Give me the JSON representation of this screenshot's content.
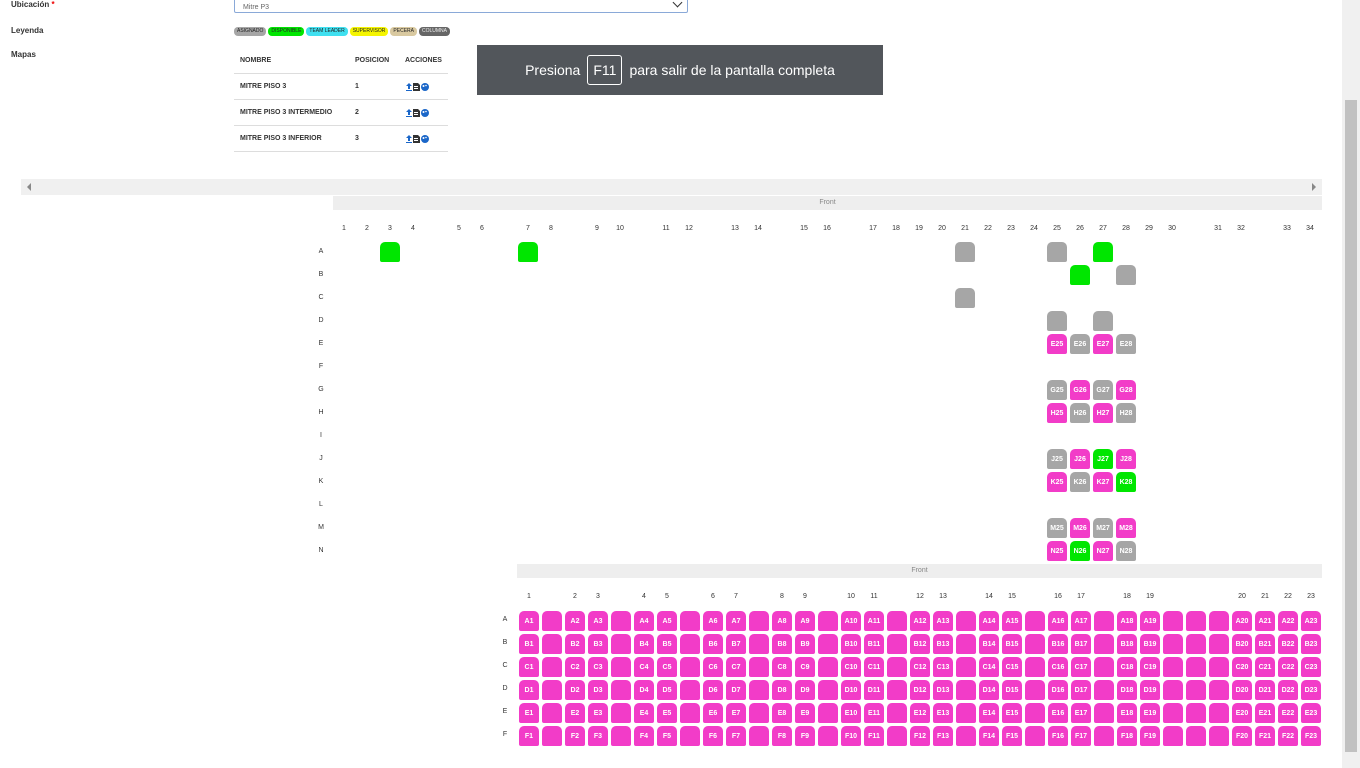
{
  "form": {
    "ubicacion_label": "Ubicación",
    "required_mark": "*",
    "ubicacion_value": "Mitre P3",
    "leyenda_label": "Leyenda",
    "mapas_label": "Mapas"
  },
  "legend": [
    {
      "label": "ASIGNADO",
      "color": "#a6a6a6"
    },
    {
      "label": "DISPONIBLE",
      "color": "#00e600"
    },
    {
      "label": "TEAM LEADER",
      "color": "#3fe0f0"
    },
    {
      "label": "SUPERVISOR",
      "color": "#f5f500"
    },
    {
      "label": "PECERA",
      "color": "#d9c9a0"
    },
    {
      "label": "COLUMNA",
      "color": "#666666"
    }
  ],
  "maps_table": {
    "headers": [
      "NOMBRE",
      "POSICION",
      "ACCIONES"
    ],
    "rows": [
      {
        "nombre": "MITRE PISO 3",
        "posicion": "1"
      },
      {
        "nombre": "MITRE PISO 3 INTERMEDIO",
        "posicion": "2"
      },
      {
        "nombre": "MITRE PISO 3 INFERIOR",
        "posicion": "3"
      }
    ],
    "action_icons": [
      "upload-icon",
      "document-icon",
      "palette-icon"
    ]
  },
  "toast": {
    "before": "Presiona",
    "key": "F11",
    "after": "para salir de la pantalla completa"
  },
  "colors": {
    "gray": "#a6a6a6",
    "green": "#00e600",
    "pink": "#f23cc8"
  },
  "map_upper": {
    "front_label": "Front",
    "col_headers": [
      "1",
      "2",
      "3",
      "4",
      "5",
      "6",
      "7",
      "8",
      "9",
      "10",
      "11",
      "12",
      "13",
      "14",
      "15",
      "16",
      "17",
      "18",
      "19",
      "20",
      "21",
      "22",
      "23",
      "24",
      "25",
      "26",
      "27",
      "28",
      "29",
      "30",
      "31",
      "32",
      "33",
      "34"
    ],
    "row_labels": [
      "A",
      "B",
      "C",
      "D",
      "E",
      "F",
      "G",
      "H",
      "I",
      "J",
      "K",
      "L",
      "M",
      "N"
    ],
    "seats": [
      {
        "row": "A",
        "col": "3",
        "label": "",
        "status": "green"
      },
      {
        "row": "A",
        "col": "7",
        "label": "",
        "status": "green"
      },
      {
        "row": "A",
        "col": "21",
        "label": "",
        "status": "gray"
      },
      {
        "row": "A",
        "col": "25",
        "label": "",
        "status": "gray"
      },
      {
        "row": "A",
        "col": "27",
        "label": "",
        "status": "green"
      },
      {
        "row": "B",
        "col": "26",
        "label": "",
        "status": "green"
      },
      {
        "row": "B",
        "col": "28",
        "label": "",
        "status": "gray"
      },
      {
        "row": "C",
        "col": "21",
        "label": "",
        "status": "gray"
      },
      {
        "row": "D",
        "col": "25",
        "label": "",
        "status": "gray"
      },
      {
        "row": "D",
        "col": "27",
        "label": "",
        "status": "gray"
      },
      {
        "row": "E",
        "col": "25",
        "label": "E25",
        "status": "pink"
      },
      {
        "row": "E",
        "col": "26",
        "label": "E26",
        "status": "gray"
      },
      {
        "row": "E",
        "col": "27",
        "label": "E27",
        "status": "pink"
      },
      {
        "row": "E",
        "col": "28",
        "label": "E28",
        "status": "gray"
      },
      {
        "row": "G",
        "col": "25",
        "label": "G25",
        "status": "gray"
      },
      {
        "row": "G",
        "col": "26",
        "label": "G26",
        "status": "pink"
      },
      {
        "row": "G",
        "col": "27",
        "label": "G27",
        "status": "gray"
      },
      {
        "row": "G",
        "col": "28",
        "label": "G28",
        "status": "pink"
      },
      {
        "row": "H",
        "col": "25",
        "label": "H25",
        "status": "pink"
      },
      {
        "row": "H",
        "col": "26",
        "label": "H26",
        "status": "gray"
      },
      {
        "row": "H",
        "col": "27",
        "label": "H27",
        "status": "pink"
      },
      {
        "row": "H",
        "col": "28",
        "label": "H28",
        "status": "gray"
      },
      {
        "row": "J",
        "col": "25",
        "label": "J25",
        "status": "gray"
      },
      {
        "row": "J",
        "col": "26",
        "label": "J26",
        "status": "pink"
      },
      {
        "row": "J",
        "col": "27",
        "label": "J27",
        "status": "green"
      },
      {
        "row": "J",
        "col": "28",
        "label": "J28",
        "status": "pink"
      },
      {
        "row": "K",
        "col": "25",
        "label": "K25",
        "status": "pink"
      },
      {
        "row": "K",
        "col": "26",
        "label": "K26",
        "status": "gray"
      },
      {
        "row": "K",
        "col": "27",
        "label": "K27",
        "status": "pink"
      },
      {
        "row": "K",
        "col": "28",
        "label": "K28",
        "status": "green"
      },
      {
        "row": "M",
        "col": "25",
        "label": "M25",
        "status": "gray"
      },
      {
        "row": "M",
        "col": "26",
        "label": "M26",
        "status": "pink"
      },
      {
        "row": "M",
        "col": "27",
        "label": "M27",
        "status": "gray"
      },
      {
        "row": "M",
        "col": "28",
        "label": "M28",
        "status": "pink"
      },
      {
        "row": "N",
        "col": "25",
        "label": "N25",
        "status": "pink"
      },
      {
        "row": "N",
        "col": "26",
        "label": "N26",
        "status": "green"
      },
      {
        "row": "N",
        "col": "27",
        "label": "N27",
        "status": "pink"
      },
      {
        "row": "N",
        "col": "28",
        "label": "N28",
        "status": "gray"
      }
    ]
  },
  "map_lower": {
    "front_label": "Front",
    "row_labels": [
      "A",
      "B",
      "C",
      "D",
      "E",
      "F"
    ],
    "columns": [
      "1",
      "",
      "2",
      "3",
      "",
      "4",
      "5",
      "",
      "6",
      "7",
      "",
      "8",
      "9",
      "",
      "10",
      "11",
      "",
      "12",
      "13",
      "",
      "14",
      "15",
      "",
      "16",
      "17",
      "",
      "18",
      "19",
      "",
      "",
      "",
      "20",
      "21",
      "22",
      "23"
    ],
    "status": "pink"
  }
}
